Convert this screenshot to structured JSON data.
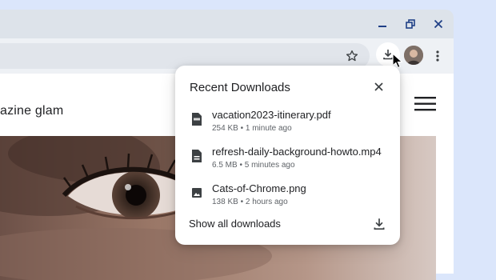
{
  "browser": {
    "site_title": "azine glam"
  },
  "downloads_panel": {
    "title": "Recent Downloads",
    "items": [
      {
        "name": "vacation2023-itinerary.pdf",
        "meta": "254 KB • 1 minute ago",
        "icon": "pdf-icon"
      },
      {
        "name": "refresh-daily-background-howto.mp4",
        "meta": "6.5 MB • 5 minutes ago",
        "icon": "file-icon"
      },
      {
        "name": "Cats-of-Chrome.png",
        "meta": "138 KB • 2 hours ago",
        "icon": "image-icon"
      }
    ],
    "show_all_label": "Show all downloads"
  },
  "colors": {
    "background": "#dbe6fb",
    "window_chrome": "#dde3ea",
    "window_controls": "#1f3f86",
    "toolbar": "#eef1f5"
  }
}
